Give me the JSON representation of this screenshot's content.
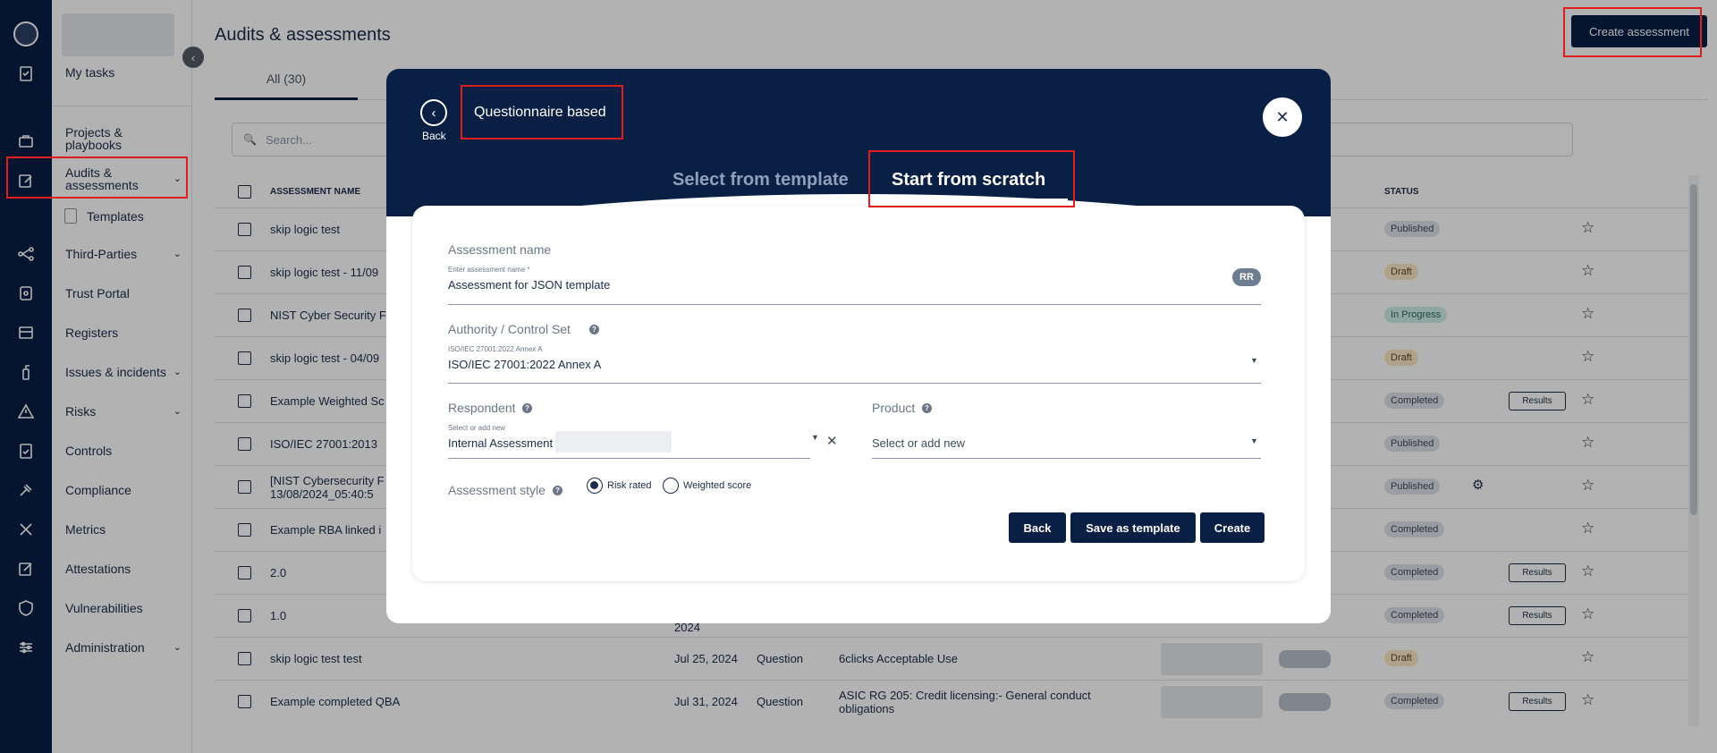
{
  "nav": {
    "my_tasks": "My tasks",
    "projects": "Projects & playbooks",
    "audits": "Audits & assessments",
    "templates": "Templates",
    "third_parties": "Third-Parties",
    "trust_portal": "Trust Portal",
    "registers": "Registers",
    "issues": "Issues & incidents",
    "risks": "Risks",
    "controls": "Controls",
    "compliance": "Compliance",
    "metrics": "Metrics",
    "attestations": "Attestations",
    "vulnerabilities": "Vulnerabilities",
    "administration": "Administration"
  },
  "header": {
    "title": "Audits & assessments",
    "create_label": "Create assessment",
    "tab_all": "All (30)",
    "search_placeholder": "Search..."
  },
  "table": {
    "col_name": "ASSESSMENT NAME",
    "col_status": "STATUS",
    "results_label": "Results",
    "rows": [
      {
        "name": "skip logic test",
        "status": "Published"
      },
      {
        "name": "skip logic test - 11/09",
        "status": "Draft"
      },
      {
        "name": "NIST Cyber Security F",
        "status": "In Progress"
      },
      {
        "name": "skip logic test - 04/09",
        "status": "Draft"
      },
      {
        "name": "Example Weighted Sc",
        "status": "Completed"
      },
      {
        "name": "ISO/IEC 27001:2013",
        "status": "Published"
      },
      {
        "name": "[NIST Cybersecurity F",
        "name2": "13/08/2024_05:40:5",
        "status": "Published"
      },
      {
        "name": "Example RBA linked i",
        "status": "Completed"
      },
      {
        "name": "2.0",
        "status": "Completed"
      },
      {
        "name": "1.0",
        "date_tail": "2024",
        "status": "Completed"
      },
      {
        "name": "skip logic test test",
        "date": "Jul 25, 2024",
        "type": "Question",
        "template": "6clicks Acceptable Use",
        "status": "Draft"
      },
      {
        "name": "Example completed QBA",
        "date": "Jul 31, 2024",
        "type": "Question",
        "template": "ASIC RG 205: Credit licensing:- General conduct",
        "template2": "obligations",
        "status": "Completed"
      }
    ]
  },
  "modal": {
    "back_label": "Back",
    "title": "Questionnaire based",
    "tab_template": "Select from template",
    "tab_scratch": "Start from scratch",
    "assessment_name_label": "Assessment name",
    "assessment_name_hint": "Enter assessment name *",
    "assessment_name_value": "Assessment for JSON template",
    "rr_badge": "RR",
    "authority_label": "Authority / Control Set",
    "authority_hint": "ISO/IEC 27001:2022 Annex A",
    "authority_value": "ISO/IEC 27001:2022 Annex A",
    "respondent_label": "Respondent",
    "respondent_hint": "Select or add new",
    "respondent_value": "Internal Assessment",
    "product_label": "Product",
    "product_placeholder": "Select or add new",
    "style_label": "Assessment style",
    "style_risk": "Risk rated",
    "style_weighted": "Weighted score",
    "btn_back": "Back",
    "btn_save_template": "Save as template",
    "btn_create": "Create",
    "help_glyph": "?",
    "close_glyph": "✕",
    "back_glyph": "‹",
    "caret_glyph": "▼",
    "clear_glyph": "✕"
  },
  "glyphs": {
    "chevron_down": "⌄",
    "chevron_left": "‹",
    "star": "☆",
    "gear": "⚙",
    "search": "🔍"
  },
  "colors": {
    "navy": "#0a1f44",
    "highlight": "#e11d1d"
  }
}
